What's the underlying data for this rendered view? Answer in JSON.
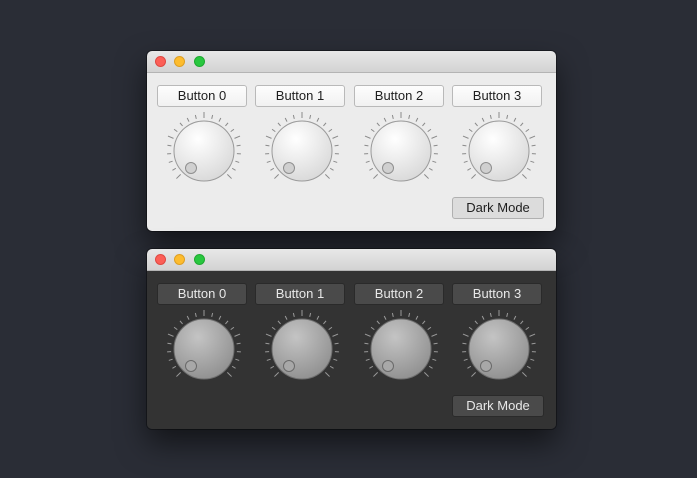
{
  "theme": {
    "desktop_bg": "#2a2d36",
    "light_window_bg": "#ececec",
    "dark_window_bg": "#333333"
  },
  "windows": [
    {
      "mode": "light",
      "buttons": [
        "Button 0",
        "Button 1",
        "Button 2",
        "Button 3"
      ],
      "dark_mode_button": "Dark Mode",
      "knob_count": 4
    },
    {
      "mode": "dark",
      "buttons": [
        "Button 0",
        "Button 1",
        "Button 2",
        "Button 3"
      ],
      "dark_mode_button": "Dark Mode",
      "knob_count": 4
    }
  ]
}
